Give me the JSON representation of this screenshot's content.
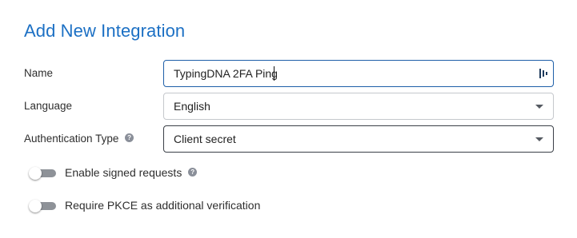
{
  "dialog": {
    "title": "Add New Integration"
  },
  "form": {
    "name": {
      "label": "Name",
      "value": "TypingDNA 2FA Ping"
    },
    "language": {
      "label": "Language",
      "selected": "English"
    },
    "authentication_type": {
      "label": "Authentication Type",
      "selected": "Client secret"
    }
  },
  "toggles": {
    "signed_requests": {
      "label": "Enable signed requests",
      "enabled": false
    },
    "pkce": {
      "label": "Require PKCE as additional verification",
      "enabled": false
    }
  },
  "icons": {
    "help": "help-icon",
    "password_manager": "password-manager-icon",
    "dropdown": "chevron-down-icon"
  },
  "colors": {
    "title": "#1c70c4",
    "focus_border": "#1e5fa8",
    "toggle_off": "#8e9298"
  }
}
